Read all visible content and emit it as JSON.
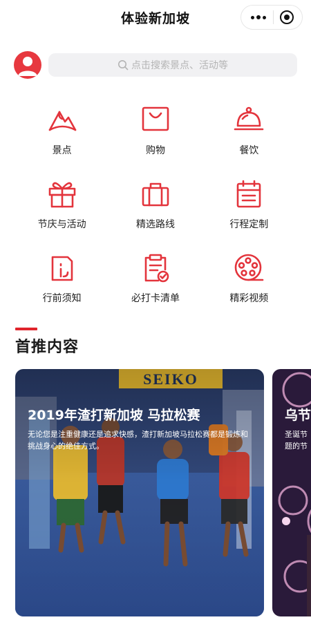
{
  "navbar": {
    "title": "体验新加坡"
  },
  "search": {
    "placeholder": "点击搜索景点、活动等"
  },
  "categories": [
    {
      "label": "景点",
      "icon": "landmark-icon"
    },
    {
      "label": "购物",
      "icon": "shopping-bag-icon"
    },
    {
      "label": "餐饮",
      "icon": "cloche-icon"
    },
    {
      "label": "节庆与活动",
      "icon": "gift-icon"
    },
    {
      "label": "精选路线",
      "icon": "briefcase-icon"
    },
    {
      "label": "行程定制",
      "icon": "planner-icon"
    },
    {
      "label": "行前须知",
      "icon": "info-doc-icon"
    },
    {
      "label": "必打卡清单",
      "icon": "clipboard-check-icon"
    },
    {
      "label": "精彩视频",
      "icon": "film-reel-icon"
    }
  ],
  "section": {
    "title": "首推内容"
  },
  "cards": [
    {
      "title": "2019年渣打新加坡 马拉松赛",
      "description": "无论您是注重健康还是追求快感，渣打新加坡马拉松赛都是锻炼和挑战身心的绝佳方式。",
      "banner_text": "SEIKO"
    },
    {
      "title": "乌节",
      "description": "圣诞节",
      "description_line2": "题的节"
    }
  ],
  "colors": {
    "accent": "#e0242c",
    "icon_red": "#e3343c"
  }
}
